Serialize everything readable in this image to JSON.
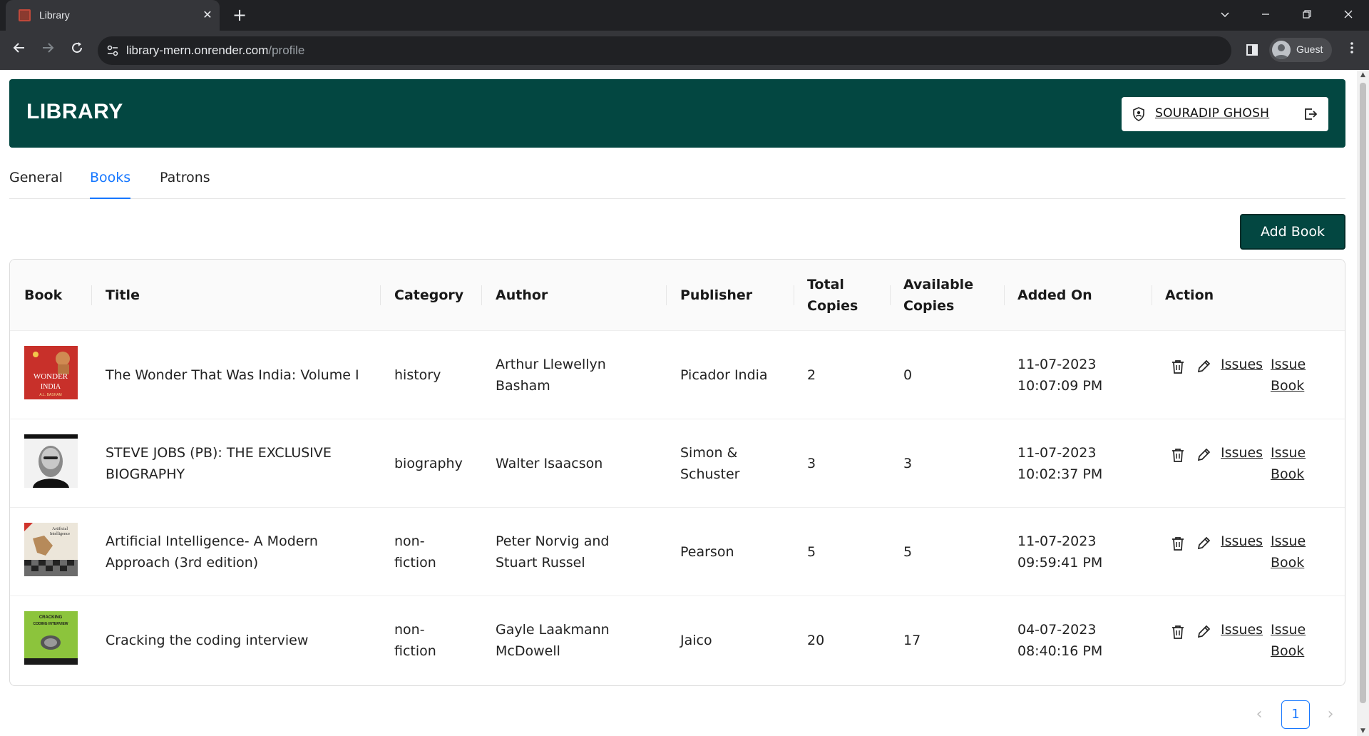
{
  "browser": {
    "tab_title": "Library",
    "tab_close": "✕",
    "new_tab": "+",
    "url_host": "library-mern.onrender.com",
    "url_path": "/profile",
    "profile_label": "Guest"
  },
  "header": {
    "brand": "LIBRARY",
    "user_name": "SOURADIP GHOSH"
  },
  "tabs": [
    {
      "label": "General",
      "active": false
    },
    {
      "label": "Books",
      "active": true
    },
    {
      "label": "Patrons",
      "active": false
    }
  ],
  "add_book_label": "Add Book",
  "table": {
    "columns": [
      "Book",
      "Title",
      "Category",
      "Author",
      "Publisher",
      "Total\nCopies",
      "Available\nCopies",
      "Added On",
      "Action"
    ],
    "rows": [
      {
        "title": "The Wonder That Was India: Volume I",
        "category": "history",
        "author": "Arthur Llewellyn\nBasham",
        "publisher": "Picador India",
        "total": "2",
        "available": "0",
        "added_date": "11-07-2023",
        "added_time": "10:07:09 PM",
        "cover_text": "THE WONDER THAT WAS INDIA",
        "cover_color": "#c8302a"
      },
      {
        "title": "STEVE JOBS (PB): THE EXCLUSIVE\nBIOGRAPHY",
        "category": "biography",
        "author": "Walter Isaacson",
        "publisher": "Simon &\nSchuster",
        "total": "3",
        "available": "3",
        "added_date": "11-07-2023",
        "added_time": "10:02:37 PM",
        "cover_text": "",
        "cover_color": "#f2f2f2"
      },
      {
        "title": "Artificial Intelligence- A Modern\nApproach (3rd edition)",
        "category": "non-\nfiction",
        "author": "Peter Norvig and\nStuart Russel",
        "publisher": "Pearson",
        "total": "5",
        "available": "5",
        "added_date": "11-07-2023",
        "added_time": "09:59:41 PM",
        "cover_text": "Artificial Intelligence",
        "cover_color": "#e9e3d8"
      },
      {
        "title": "Cracking the coding interview",
        "category": "non-\nfiction",
        "author": "Gayle Laakmann\nMcDowell",
        "publisher": "Jaico",
        "total": "20",
        "available": "17",
        "added_date": "04-07-2023",
        "added_time": "08:40:16 PM",
        "cover_text": "CRACKING CODING INTERVIEW",
        "cover_color": "#8cc43c"
      }
    ],
    "action_issues": "Issues",
    "action_issue_book_1": "Issue",
    "action_issue_book_2": "Book"
  },
  "pagination": {
    "current_page": "1",
    "prev": "‹",
    "next": "›"
  },
  "colors": {
    "brand": "#034741",
    "link_active": "#1677ff"
  }
}
